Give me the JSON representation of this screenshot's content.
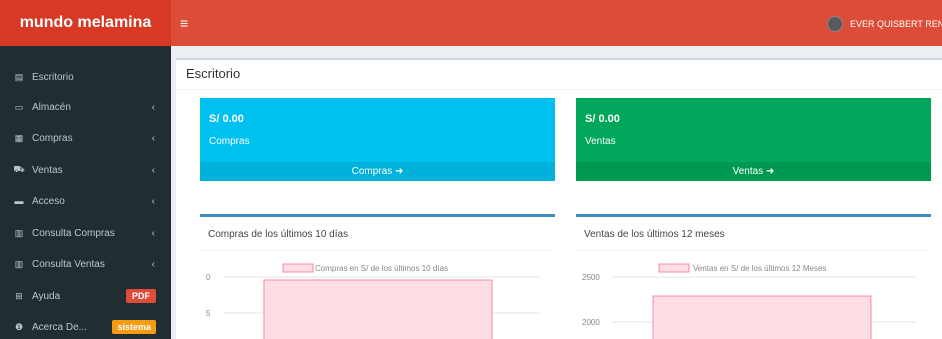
{
  "brand": "mundo melamina",
  "menu_toggle": "≡",
  "user": {
    "name": "EVER QUISBERT RENG"
  },
  "sidebar": {
    "items": [
      {
        "label": "Escritorio",
        "icon": "dashboard-icon",
        "glyph": "▤",
        "chevron": ""
      },
      {
        "label": "Almacén",
        "icon": "laptop-icon",
        "glyph": "▭",
        "chevron": "‹"
      },
      {
        "label": "Compras",
        "icon": "grid-icon",
        "glyph": "▦",
        "chevron": "‹"
      },
      {
        "label": "Ventas",
        "icon": "cart-icon",
        "glyph": "⛟",
        "chevron": "‹"
      },
      {
        "label": "Acceso",
        "icon": "folder-icon",
        "glyph": "▬",
        "chevron": "‹"
      },
      {
        "label": "Consulta Compras",
        "icon": "bar-chart-icon",
        "glyph": "▥",
        "chevron": "‹"
      },
      {
        "label": "Consulta Ventas",
        "icon": "bar-chart-icon",
        "glyph": "▥",
        "chevron": "‹"
      },
      {
        "label": "Ayuda",
        "icon": "plus-square-icon",
        "glyph": "⊞",
        "badge": "PDF"
      },
      {
        "label": "Acerca De...",
        "icon": "info-icon",
        "glyph": "❶",
        "badge": "sistema"
      }
    ]
  },
  "page": {
    "title": "Escritorio"
  },
  "boxes": {
    "compras": {
      "amount": "S/ 0.00",
      "label": "Compras",
      "footer": "Compras",
      "color": "#00c0ef"
    },
    "ventas": {
      "amount": "S/ 0.00",
      "label": "Ventas",
      "footer": "Ventas",
      "color": "#00a65a"
    }
  },
  "charts_titles": {
    "compras": "Compras de los últimos 10 días",
    "ventas": "Ventas de los últimos 12 meses"
  },
  "chart_data": [
    {
      "type": "bar",
      "legend": "Compras en S/ de los últimos 10 días",
      "series": [
        {
          "name": "Compras en S/ de los últimos 10 días",
          "values": [
            0
          ]
        }
      ],
      "categories": [
        ""
      ],
      "yticks": [
        "0",
        "5"
      ],
      "bar_fill": "#ffdde4",
      "bar_stroke": "#f28fa6"
    },
    {
      "type": "bar",
      "legend": "Ventas en S/ de los últimos 12 Meses",
      "series": [
        {
          "name": "Ventas en S/ de los últimos 12 Meses",
          "values": [
            2320
          ]
        }
      ],
      "categories": [
        ""
      ],
      "yticks": [
        "2500",
        "2000"
      ],
      "bar_fill": "#ffdde4",
      "bar_stroke": "#f28fa6"
    }
  ]
}
